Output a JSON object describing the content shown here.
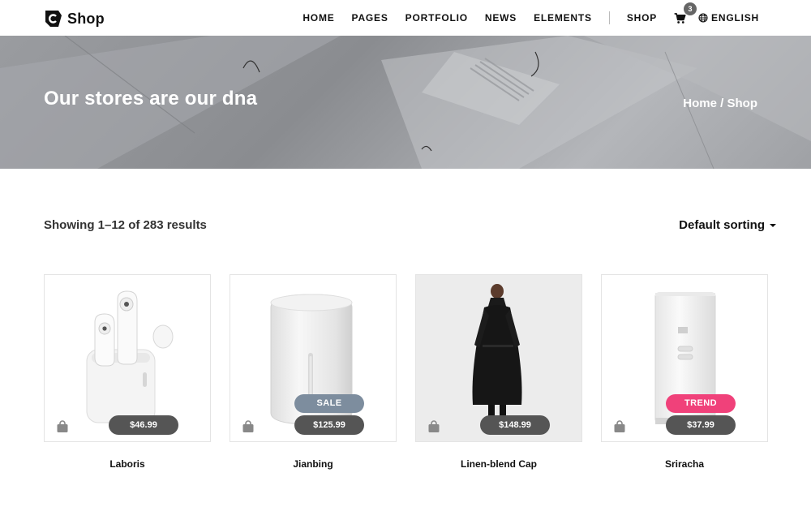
{
  "brand": {
    "name": "Shop"
  },
  "nav": {
    "items": [
      {
        "label": "HOME"
      },
      {
        "label": "PAGES"
      },
      {
        "label": "PORTFOLIO"
      },
      {
        "label": "NEWS"
      },
      {
        "label": "ELEMENTS"
      }
    ],
    "shop_label": "SHOP",
    "cart_count": "3",
    "cart_icon": "cart-icon",
    "language_icon": "globe-icon",
    "language": "ENGLISH"
  },
  "hero": {
    "title": "Our stores are our dna",
    "breadcrumb": {
      "home": "Home",
      "separator": " / ",
      "current": "Shop"
    }
  },
  "toolbar": {
    "results": "Showing 1–12 of 283 results",
    "sort_label": "Default sorting"
  },
  "products": [
    {
      "name": "Laboris",
      "price": "$46.99",
      "badge": null
    },
    {
      "name": "Jianbing",
      "price": "$125.99",
      "badge": "SALE",
      "badge_color": "#7d8d9e"
    },
    {
      "name": "Linen-blend Cap",
      "price": "$148.99",
      "badge": null
    },
    {
      "name": "Sriracha",
      "price": "$37.99",
      "badge": "TREND",
      "badge_color": "#f0417a"
    }
  ],
  "colors": {
    "accent_dark": "#555555",
    "sale": "#7d8d9e",
    "trend": "#f0417a"
  }
}
